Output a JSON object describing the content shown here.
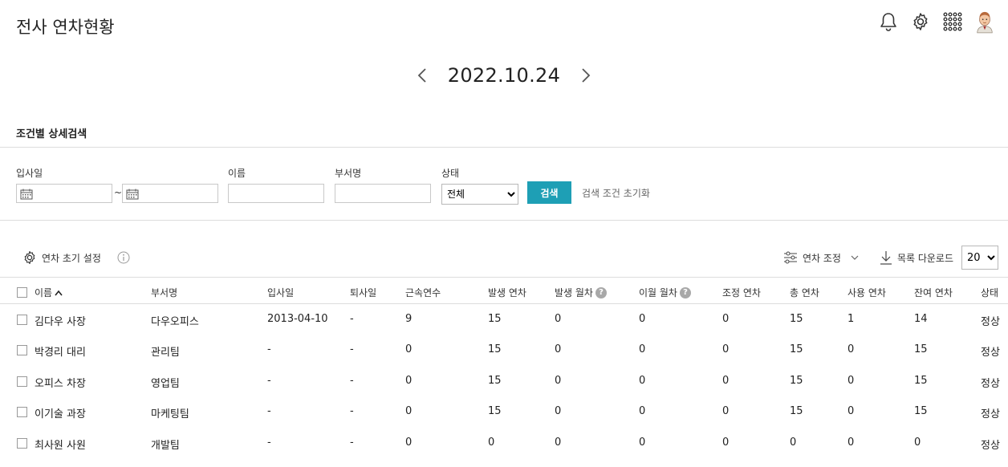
{
  "header": {
    "title": "전사 연차현황",
    "icons": [
      "bell-icon",
      "gear-icon",
      "apps-grid-icon",
      "avatar"
    ]
  },
  "date_nav": {
    "date": "2022.10.24"
  },
  "search": {
    "section_title": "조건별 상세검색",
    "join_date_label": "입사일",
    "tilde": "~",
    "name_label": "이름",
    "dept_label": "부서명",
    "status_label": "상태",
    "status_selected": "전체",
    "search_button": "검색",
    "reset_link": "검색 조건 초기화"
  },
  "toolbar": {
    "init_settings": "연차 초기 설정",
    "adjust": "연차 조정",
    "download": "목록 다운로드",
    "page_size": "20"
  },
  "table": {
    "columns": [
      "이름",
      "부서명",
      "입사일",
      "퇴사일",
      "근속연수",
      "발생 연차",
      "발생 월차",
      "이월 월차",
      "조정 연차",
      "총 연차",
      "사용 연차",
      "잔여 연차",
      "상태"
    ],
    "rows": [
      [
        "김다우 사장",
        "다우오피스",
        "2013-04-10",
        "-",
        "9",
        "15",
        "0",
        "0",
        "0",
        "15",
        "1",
        "14",
        "정상"
      ],
      [
        "박경리 대리",
        "관리팀",
        "-",
        "-",
        "0",
        "15",
        "0",
        "0",
        "0",
        "15",
        "0",
        "15",
        "정상"
      ],
      [
        "오피스 차장",
        "영업팀",
        "-",
        "-",
        "0",
        "15",
        "0",
        "0",
        "0",
        "15",
        "0",
        "15",
        "정상"
      ],
      [
        "이기술 과장",
        "마케팅팀",
        "-",
        "-",
        "0",
        "15",
        "0",
        "0",
        "0",
        "15",
        "0",
        "15",
        "정상"
      ],
      [
        "최사원 사원",
        "개발팀",
        "-",
        "-",
        "0",
        "0",
        "0",
        "0",
        "0",
        "0",
        "0",
        "0",
        "정상"
      ]
    ]
  }
}
